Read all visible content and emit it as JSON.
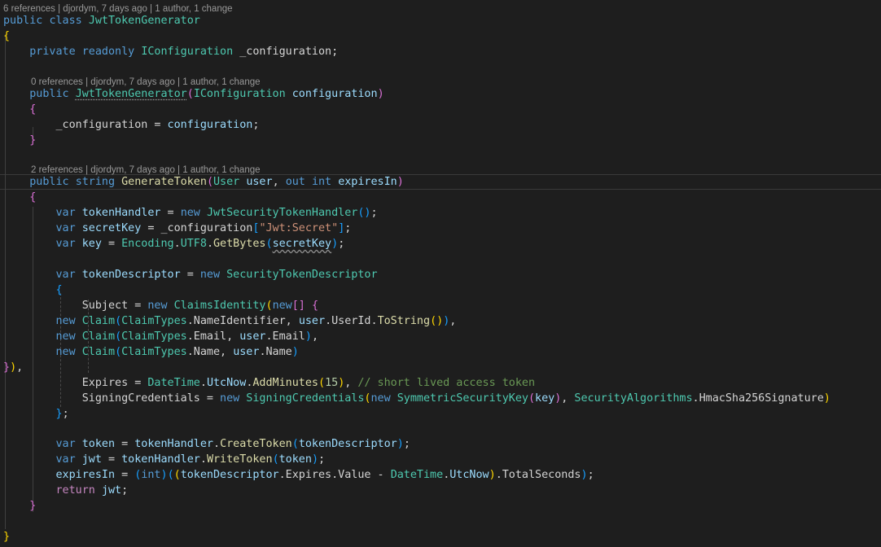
{
  "lens": {
    "class_refs": "6 references | djordym, 7 days ago | 1 author, 1 change",
    "ctor_refs": "0 references | djordym, 7 days ago | 1 author, 1 change",
    "method_refs": "2 references | djordym, 7 days ago | 1 author, 1 change"
  },
  "code": [
    [
      [
        "kw",
        "public"
      ],
      [
        "pl",
        " "
      ],
      [
        "kw",
        "class"
      ],
      [
        "pl",
        " "
      ],
      [
        "ty",
        "JwtTokenGenerator"
      ]
    ],
    [
      [
        "br",
        "{"
      ]
    ],
    [
      [
        "pl",
        "    "
      ],
      [
        "kw",
        "private"
      ],
      [
        "pl",
        " "
      ],
      [
        "kw",
        "readonly"
      ],
      [
        "pl",
        " "
      ],
      [
        "ty",
        "IConfiguration"
      ],
      [
        "pl",
        " _configuration;"
      ]
    ],
    [
      [
        "pl",
        "    "
      ],
      [
        "kw",
        "public"
      ],
      [
        "pl",
        " "
      ],
      [
        "ty",
        "JwtTokenGenerator",
        "dots"
      ],
      [
        "br2",
        "("
      ],
      [
        "ty",
        "IConfiguration"
      ],
      [
        "pl",
        " "
      ],
      [
        "pa",
        "configuration"
      ],
      [
        "br2",
        ")"
      ]
    ],
    [
      [
        "pl",
        "    "
      ],
      [
        "br2",
        "{"
      ]
    ],
    [
      [
        "pl",
        "        _configuration = "
      ],
      [
        "pa",
        "configuration"
      ],
      [
        "pl",
        ";"
      ]
    ],
    [
      [
        "pl",
        "    "
      ],
      [
        "br2",
        "}"
      ]
    ],
    [
      [
        "pl",
        "    "
      ],
      [
        "kw",
        "public"
      ],
      [
        "pl",
        " "
      ],
      [
        "kw",
        "string"
      ],
      [
        "pl",
        " "
      ],
      [
        "fn",
        "GenerateToken"
      ],
      [
        "br2",
        "("
      ],
      [
        "ty",
        "User"
      ],
      [
        "pl",
        " "
      ],
      [
        "pa",
        "user"
      ],
      [
        "pl",
        ", "
      ],
      [
        "kw",
        "out"
      ],
      [
        "pl",
        " "
      ],
      [
        "kw",
        "int"
      ],
      [
        "pl",
        " "
      ],
      [
        "pa",
        "expiresIn"
      ],
      [
        "br2",
        ")"
      ]
    ],
    [
      [
        "pl",
        "    "
      ],
      [
        "br2",
        "{"
      ]
    ],
    [
      [
        "pl",
        "        "
      ],
      [
        "kw",
        "var"
      ],
      [
        "pl",
        " "
      ],
      [
        "pa",
        "tokenHandler"
      ],
      [
        "pl",
        " = "
      ],
      [
        "kw",
        "new"
      ],
      [
        "pl",
        " "
      ],
      [
        "ty",
        "JwtSecurityTokenHandler"
      ],
      [
        "br3",
        "()"
      ],
      [
        "pl",
        ";"
      ]
    ],
    [
      [
        "pl",
        "        "
      ],
      [
        "kw",
        "var"
      ],
      [
        "pl",
        " "
      ],
      [
        "pa",
        "secretKey"
      ],
      [
        "pl",
        " = _configuration"
      ],
      [
        "br3",
        "["
      ],
      [
        "st",
        "\"Jwt:Secret\""
      ],
      [
        "br3",
        "]"
      ],
      [
        "pl",
        ";"
      ]
    ],
    [
      [
        "pl",
        "        "
      ],
      [
        "kw",
        "var"
      ],
      [
        "pl",
        " "
      ],
      [
        "pa",
        "key"
      ],
      [
        "pl",
        " = "
      ],
      [
        "ty",
        "Encoding"
      ],
      [
        "pl",
        "."
      ],
      [
        "ty",
        "UTF8"
      ],
      [
        "pl",
        "."
      ],
      [
        "fn",
        "GetBytes"
      ],
      [
        "br3",
        "("
      ],
      [
        "pa",
        "secretKey",
        "squig"
      ],
      [
        "br3",
        ")"
      ],
      [
        "pl",
        ";"
      ]
    ],
    [
      [
        "pl",
        "        "
      ],
      [
        "kw",
        "var"
      ],
      [
        "pl",
        " "
      ],
      [
        "pa",
        "tokenDescriptor"
      ],
      [
        "pl",
        " = "
      ],
      [
        "kw",
        "new"
      ],
      [
        "pl",
        " "
      ],
      [
        "ty",
        "SecurityTokenDescriptor"
      ]
    ],
    [
      [
        "pl",
        "        "
      ],
      [
        "br3",
        "{"
      ]
    ],
    [
      [
        "pl",
        "            Subject = "
      ],
      [
        "kw",
        "new"
      ],
      [
        "pl",
        " "
      ],
      [
        "ty",
        "ClaimsIdentity"
      ],
      [
        "br",
        "("
      ],
      [
        "kw",
        "new"
      ],
      [
        "br2",
        "[]"
      ],
      [
        "pl",
        " "
      ],
      [
        "br2",
        "{"
      ]
    ],
    [
      [
        "pl",
        "        "
      ],
      [
        "kw",
        "new"
      ],
      [
        "pl",
        " "
      ],
      [
        "ty",
        "Claim"
      ],
      [
        "br3",
        "("
      ],
      [
        "ty",
        "ClaimTypes"
      ],
      [
        "pl",
        ".NameIdentifier, "
      ],
      [
        "pa",
        "user"
      ],
      [
        "pl",
        ".UserId."
      ],
      [
        "fn",
        "ToString"
      ],
      [
        "br",
        "()"
      ],
      [
        "br3",
        ")"
      ],
      [
        "pl",
        ","
      ]
    ],
    [
      [
        "pl",
        "        "
      ],
      [
        "kw",
        "new"
      ],
      [
        "pl",
        " "
      ],
      [
        "ty",
        "Claim"
      ],
      [
        "br3",
        "("
      ],
      [
        "ty",
        "ClaimTypes"
      ],
      [
        "pl",
        ".Email, "
      ],
      [
        "pa",
        "user"
      ],
      [
        "pl",
        ".Email"
      ],
      [
        "br3",
        ")"
      ],
      [
        "pl",
        ","
      ]
    ],
    [
      [
        "pl",
        "        "
      ],
      [
        "kw",
        "new"
      ],
      [
        "pl",
        " "
      ],
      [
        "ty",
        "Claim"
      ],
      [
        "br3",
        "("
      ],
      [
        "ty",
        "ClaimTypes"
      ],
      [
        "pl",
        ".Name, "
      ],
      [
        "pa",
        "user"
      ],
      [
        "pl",
        ".Name"
      ],
      [
        "br3",
        ")"
      ]
    ],
    [
      [
        "br2",
        "}"
      ],
      [
        "br",
        ")"
      ],
      [
        "pl",
        ","
      ]
    ],
    [
      [
        "pl",
        "            Expires = "
      ],
      [
        "ty",
        "DateTime"
      ],
      [
        "pl",
        "."
      ],
      [
        "pa",
        "UtcNow"
      ],
      [
        "pl",
        "."
      ],
      [
        "fn",
        "AddMinutes"
      ],
      [
        "br",
        "("
      ],
      [
        "nu",
        "15"
      ],
      [
        "br",
        ")"
      ],
      [
        "pl",
        ", "
      ],
      [
        "cm",
        "// short lived access token"
      ]
    ],
    [
      [
        "pl",
        "            SigningCredentials = "
      ],
      [
        "kw",
        "new"
      ],
      [
        "pl",
        " "
      ],
      [
        "ty",
        "SigningCredentials"
      ],
      [
        "br",
        "("
      ],
      [
        "kw",
        "new"
      ],
      [
        "pl",
        " "
      ],
      [
        "ty",
        "SymmetricSecurityKey"
      ],
      [
        "br2",
        "("
      ],
      [
        "pa",
        "key"
      ],
      [
        "br2",
        ")"
      ],
      [
        "pl",
        ", "
      ],
      [
        "ty",
        "SecurityAlgorithms"
      ],
      [
        "pl",
        ".HmacSha256Signature"
      ],
      [
        "br",
        ")"
      ]
    ],
    [
      [
        "pl",
        "        "
      ],
      [
        "br3",
        "}"
      ],
      [
        "pl",
        ";"
      ]
    ],
    [
      [
        "pl",
        "        "
      ],
      [
        "kw",
        "var"
      ],
      [
        "pl",
        " "
      ],
      [
        "pa",
        "token"
      ],
      [
        "pl",
        " = "
      ],
      [
        "pa",
        "tokenHandler"
      ],
      [
        "pl",
        "."
      ],
      [
        "fn",
        "CreateToken"
      ],
      [
        "br3",
        "("
      ],
      [
        "pa",
        "tokenDescriptor"
      ],
      [
        "br3",
        ")"
      ],
      [
        "pl",
        ";"
      ]
    ],
    [
      [
        "pl",
        "        "
      ],
      [
        "kw",
        "var"
      ],
      [
        "pl",
        " "
      ],
      [
        "pa",
        "jwt"
      ],
      [
        "pl",
        " = "
      ],
      [
        "pa",
        "tokenHandler"
      ],
      [
        "pl",
        "."
      ],
      [
        "fn",
        "WriteToken"
      ],
      [
        "br3",
        "("
      ],
      [
        "pa",
        "token"
      ],
      [
        "br3",
        ")"
      ],
      [
        "pl",
        ";"
      ]
    ],
    [
      [
        "pl",
        "        "
      ],
      [
        "pa",
        "expiresIn"
      ],
      [
        "pl",
        " = "
      ],
      [
        "br3",
        "("
      ],
      [
        "kw",
        "int"
      ],
      [
        "br3",
        ")"
      ],
      [
        "br3",
        "("
      ],
      [
        "br",
        "("
      ],
      [
        "pa",
        "tokenDescriptor"
      ],
      [
        "pl",
        ".Expires.Value - "
      ],
      [
        "ty",
        "DateTime"
      ],
      [
        "pl",
        "."
      ],
      [
        "pa",
        "UtcNow"
      ],
      [
        "br",
        ")"
      ],
      [
        "pl",
        ".TotalSeconds"
      ],
      [
        "br3",
        ")"
      ],
      [
        "pl",
        ";"
      ]
    ],
    [
      [
        "pl",
        "        "
      ],
      [
        "kc",
        "return"
      ],
      [
        "pl",
        " "
      ],
      [
        "pa",
        "jwt"
      ],
      [
        "pl",
        ";"
      ]
    ],
    [
      [
        "pl",
        "    "
      ],
      [
        "br2",
        "}"
      ]
    ],
    [
      [
        "br",
        "}"
      ]
    ]
  ]
}
